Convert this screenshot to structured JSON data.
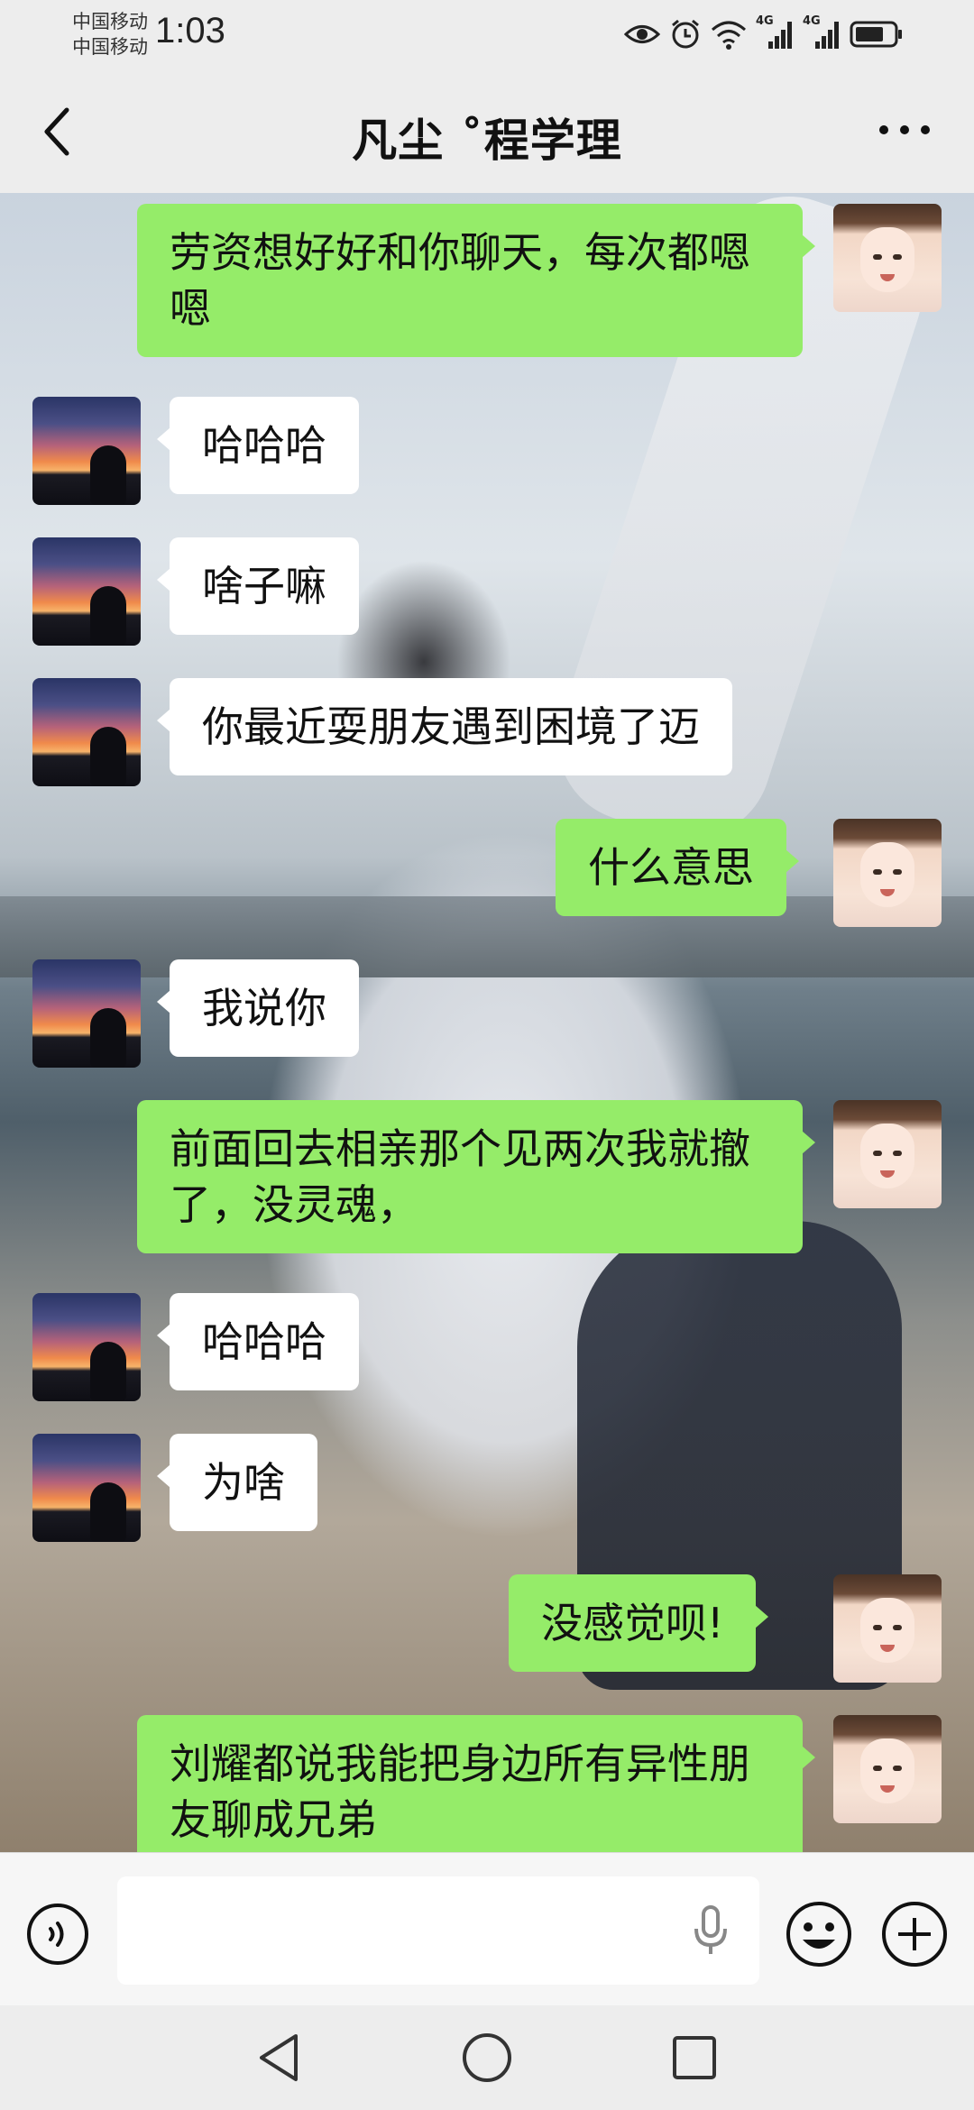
{
  "status_bar": {
    "carrier1": "中国移动",
    "carrier2": "中国移动",
    "time": "1:03",
    "net1": "4G",
    "net2": "4G",
    "icons": [
      "eye-icon",
      "alarm-icon",
      "wifi-icon",
      "signal-icon",
      "signal-icon",
      "battery-icon"
    ]
  },
  "header": {
    "title": "凡尘  ˚程学理",
    "back_icon": "chevron-left-icon",
    "more_icon": "more-dots-icon"
  },
  "messages": [
    {
      "side": "right",
      "text": "劳资想好好和你聊天，每次都嗯嗯",
      "avatar": "girl"
    },
    {
      "side": "left",
      "text": "哈哈哈",
      "avatar": "sunset"
    },
    {
      "side": "left",
      "text": "啥子嘛",
      "avatar": "sunset"
    },
    {
      "side": "left",
      "text": "你最近耍朋友遇到困境了迈",
      "avatar": "sunset"
    },
    {
      "side": "right",
      "text": "什么意思",
      "avatar": "girl"
    },
    {
      "side": "left",
      "text": "我说你",
      "avatar": "sunset"
    },
    {
      "side": "right",
      "text": "前面回去相亲那个见两次我就撤了，没灵魂，",
      "avatar": "girl"
    },
    {
      "side": "left",
      "text": "哈哈哈",
      "avatar": "sunset"
    },
    {
      "side": "left",
      "text": "为啥",
      "avatar": "sunset"
    },
    {
      "side": "right",
      "text": "没感觉呗!",
      "avatar": "girl"
    },
    {
      "side": "right",
      "text": "刘耀都说我能把身边所有异性朋友聊成兄弟",
      "avatar": "girl"
    }
  ],
  "input_bar": {
    "value": "",
    "voice_icon": "voice-icon",
    "mic_icon": "microphone-icon",
    "emoji_icon": "emoji-icon",
    "plus_icon": "plus-circle-icon"
  },
  "colors": {
    "bubble_self": "#95ec69",
    "bubble_other": "#ffffff",
    "bar_background": "#ededed"
  }
}
